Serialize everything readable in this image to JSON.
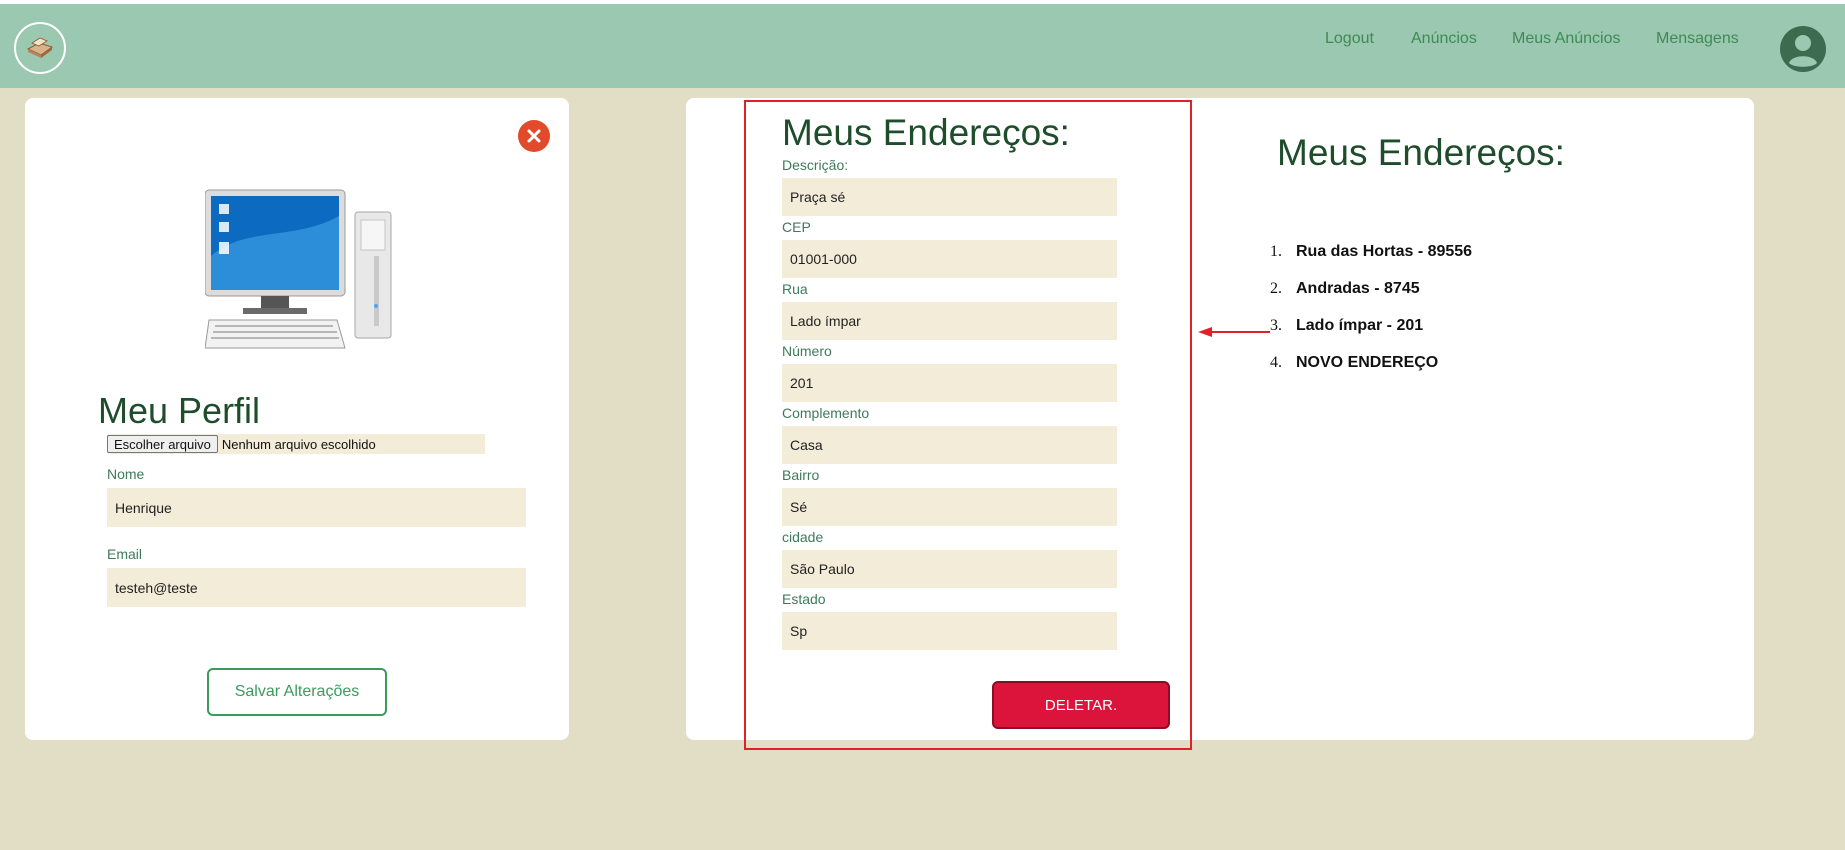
{
  "nav": {
    "logout": "Logout",
    "anuncios": "Anúncios",
    "meus_anuncios": "Meus Anúncios",
    "mensagens": "Mensagens"
  },
  "profile": {
    "title": "Meu Perfil",
    "file_button": "Escolher arquivo",
    "file_status": "Nenhum arquivo escolhido",
    "name_label": "Nome",
    "name_value": "Henrique",
    "email_label": "Email",
    "email_value": "testeh@teste",
    "save_button": "Salvar Alterações"
  },
  "address_form": {
    "title": "Meus Endereços:",
    "fields": [
      {
        "label": "Descrição:",
        "value": "Praça sé"
      },
      {
        "label": "CEP",
        "value": "01001-000"
      },
      {
        "label": "Rua",
        "value": "Lado ímpar"
      },
      {
        "label": "Número",
        "value": "201"
      },
      {
        "label": "Complemento",
        "value": "Casa"
      },
      {
        "label": "Bairro",
        "value": "Sé"
      },
      {
        "label": "cidade",
        "value": "São Paulo"
      },
      {
        "label": "Estado",
        "value": "Sp"
      }
    ],
    "delete_button": "DELETAR."
  },
  "address_list": {
    "title": "Meus Endereços:",
    "items": [
      {
        "num": "1.",
        "text": "Rua das Hortas - 89556"
      },
      {
        "num": "2.",
        "text": "Andradas - 8745"
      },
      {
        "num": "3.",
        "text": "Lado ímpar - 201"
      },
      {
        "num": "4.",
        "text": "NOVO ENDEREÇO"
      }
    ]
  },
  "colors": {
    "header": "#9bc8b1",
    "background": "#e2ddc5",
    "field_bg": "#f3ecd8",
    "title_green": "#1e4d2b",
    "delete_red": "#dc143c",
    "highlight_red": "#e2202a"
  }
}
